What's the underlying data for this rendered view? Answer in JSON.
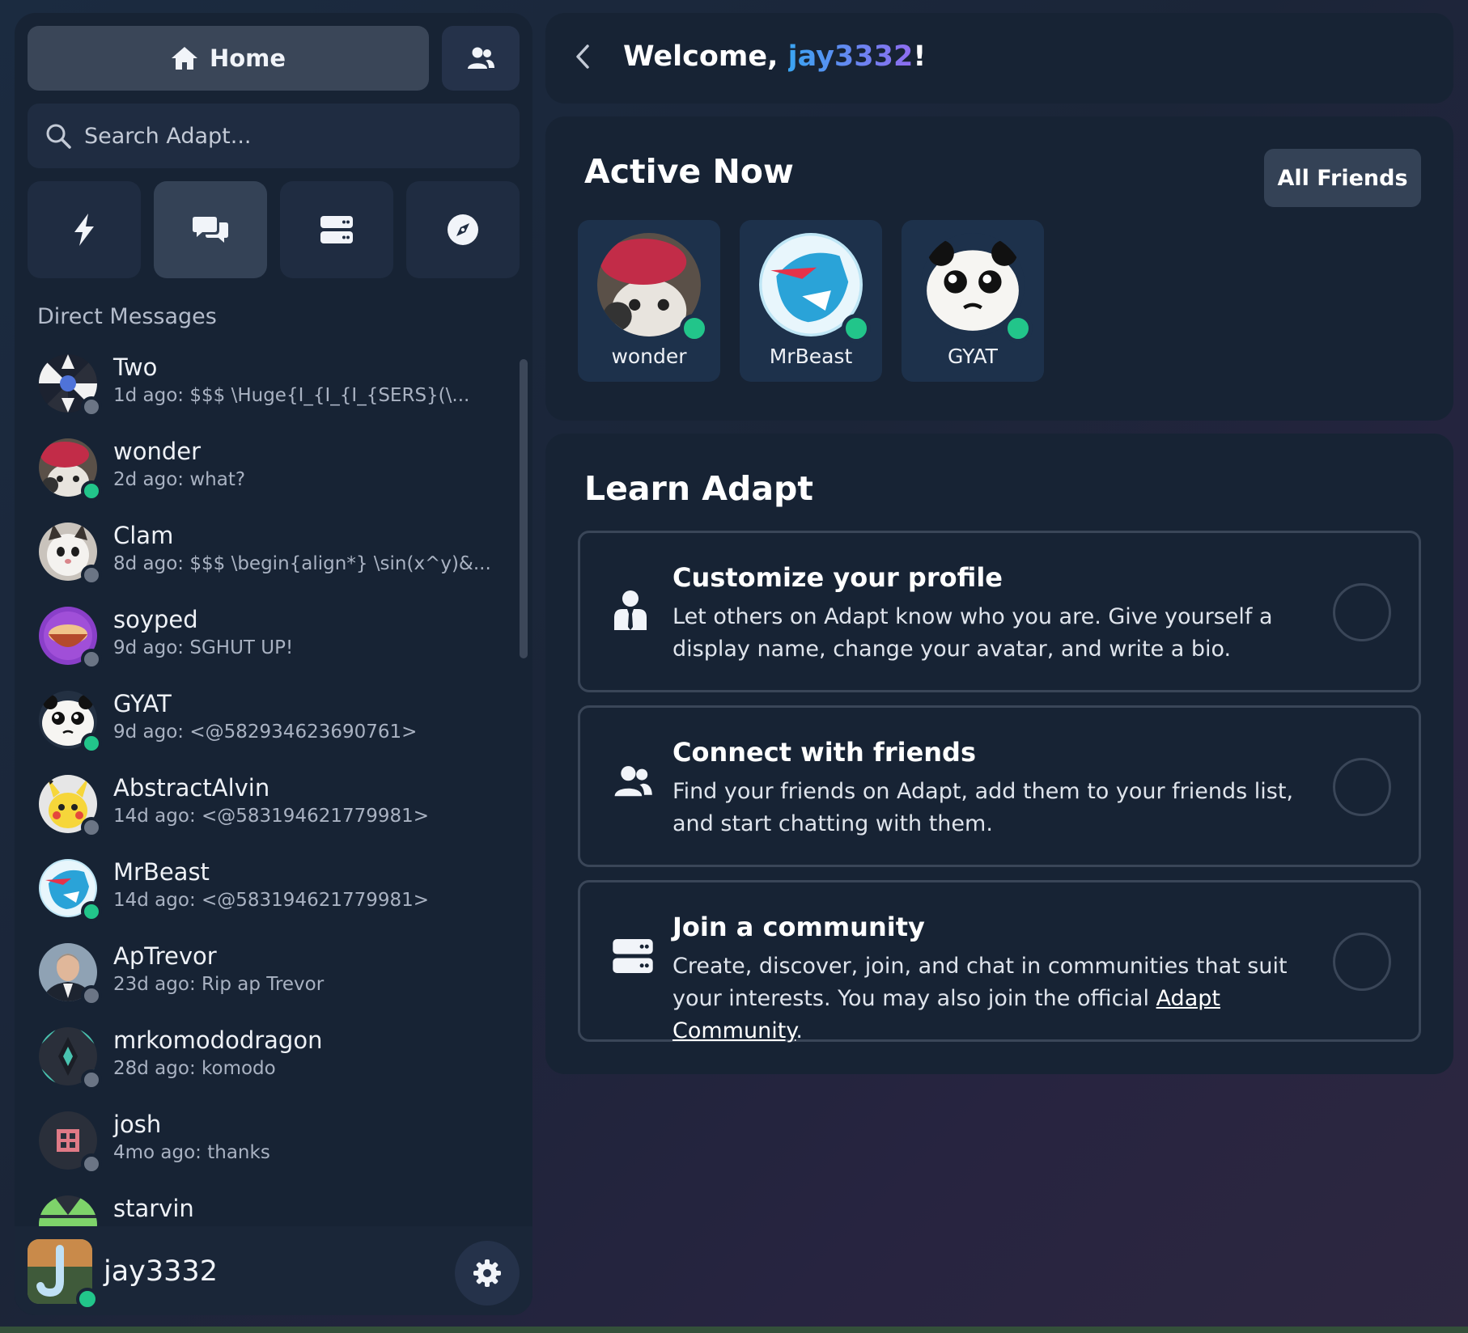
{
  "app": {
    "home_label": "Home",
    "search_placeholder": "Search Adapt...",
    "nav_icons": [
      "bolt-icon",
      "chat-bubbles-icon",
      "server-icon",
      "compass-icon"
    ]
  },
  "sidebar": {
    "section_title": "Direct Messages",
    "dms": [
      {
        "name": "Two",
        "preview": "1d ago: $$$ \\Huge{I_{I_{I_{SERS}(\\...",
        "status": "offline"
      },
      {
        "name": "wonder",
        "preview": "2d ago: what?",
        "status": "online"
      },
      {
        "name": "Clam",
        "preview": "8d ago: $$$ \\begin{align*} \\sin(x^y)&...",
        "status": "offline"
      },
      {
        "name": "soyped",
        "preview": "9d ago: SGHUT UP!",
        "status": "offline"
      },
      {
        "name": "GYAT",
        "preview": "9d ago: <@582934623690761>",
        "status": "online"
      },
      {
        "name": "AbstractAlvin",
        "preview": "14d ago: <@583194621779981>",
        "status": "offline"
      },
      {
        "name": "MrBeast",
        "preview": "14d ago: <@583194621779981>",
        "status": "online"
      },
      {
        "name": "ApTrevor",
        "preview": "23d ago: Rip ap Trevor",
        "status": "offline"
      },
      {
        "name": "mrkomododragon",
        "preview": "28d ago: komodo",
        "status": "offline"
      },
      {
        "name": "josh",
        "preview": "4mo ago: thanks",
        "status": "offline"
      },
      {
        "name": "starvin",
        "preview": "",
        "status": "offline"
      }
    ],
    "current_user": {
      "name": "jay3332",
      "status": "online"
    }
  },
  "header": {
    "welcome_prefix": "Welcome, ",
    "username": "jay3332",
    "welcome_suffix": "!"
  },
  "active_now": {
    "title": "Active Now",
    "all_friends_label": "All Friends",
    "friends": [
      {
        "name": "wonder"
      },
      {
        "name": "MrBeast"
      },
      {
        "name": "GYAT"
      }
    ]
  },
  "learn": {
    "title": "Learn Adapt",
    "tasks": [
      {
        "title": "Customize your profile",
        "description": "Let others on Adapt know who you are. Give yourself a display name, change your avatar, and write a bio.",
        "icon": "user-profile-icon"
      },
      {
        "title": "Connect with friends",
        "description": "Find your friends on Adapt, add them to your friends list, and start chatting with them.",
        "icon": "users-icon"
      },
      {
        "title": "Join a community",
        "description_before": "Create, discover, join, and chat in communities that suit your interests. You may also join the official ",
        "link": "Adapt Community",
        "description_after": ".",
        "icon": "server-icon"
      }
    ]
  },
  "colors": {
    "online": "#22c58a",
    "offline": "#6b7585",
    "accent_gradient_start": "#3aa4f2",
    "accent_gradient_end": "#8f6cf0"
  }
}
